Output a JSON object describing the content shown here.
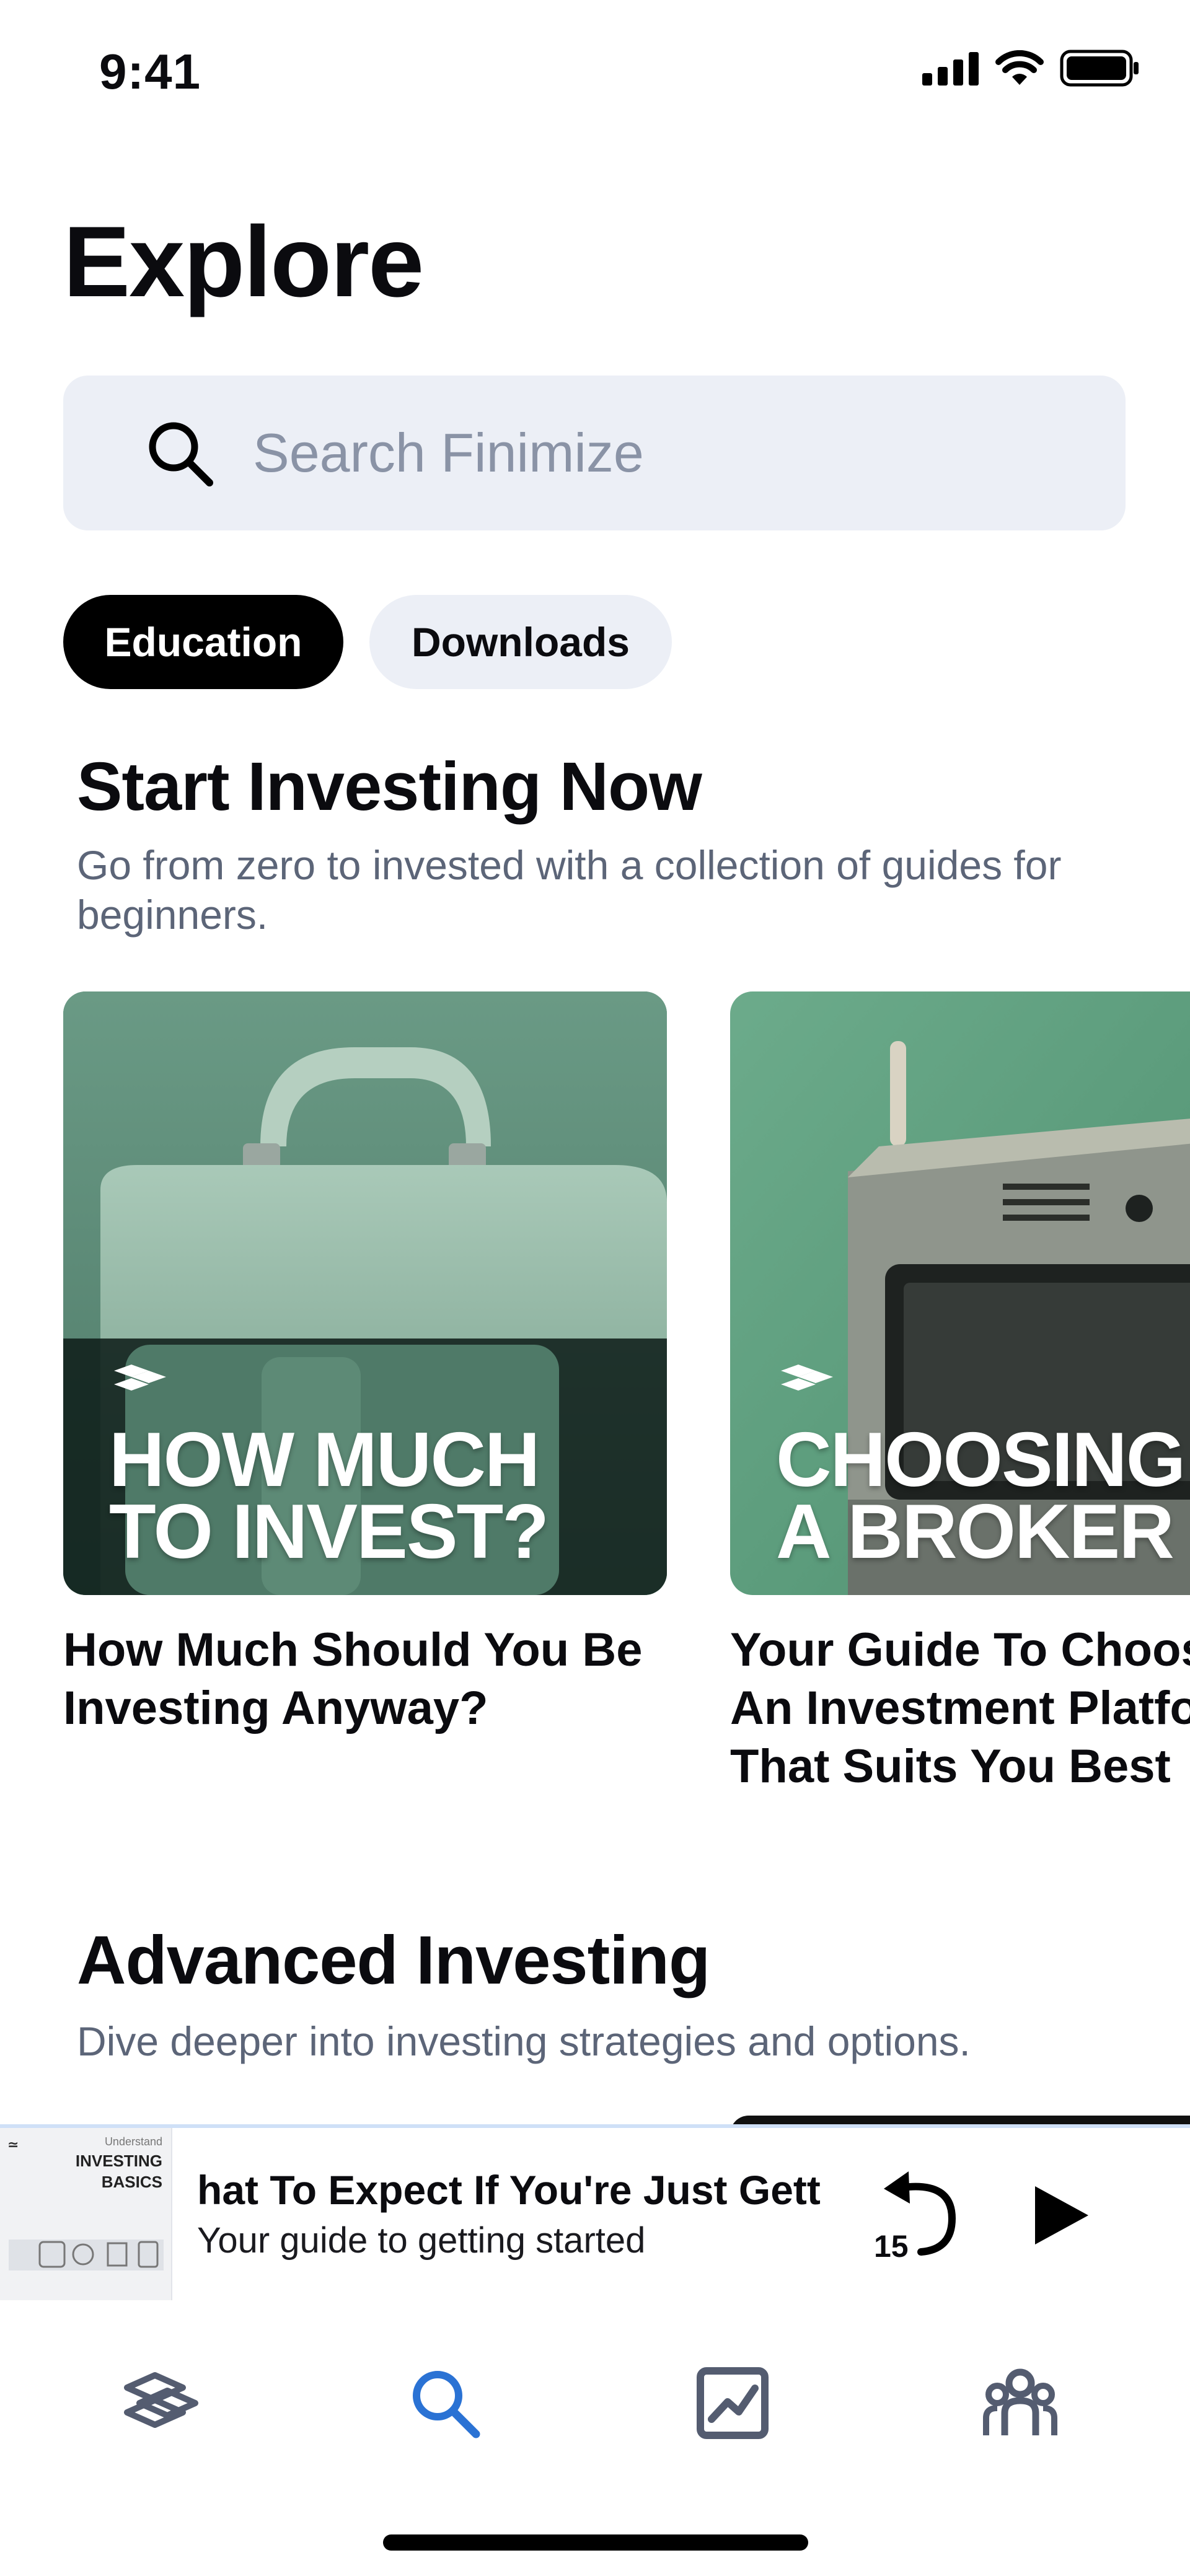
{
  "status_bar": {
    "time": "9:41"
  },
  "page": {
    "title": "Explore"
  },
  "search": {
    "placeholder": "Search Finimize"
  },
  "tabs": [
    {
      "label": "Education",
      "active": true
    },
    {
      "label": "Downloads",
      "active": false
    }
  ],
  "sections": [
    {
      "title": "Start Investing Now",
      "subtitle": "Go from zero to invested with a collection of guides for beginners.",
      "cards": [
        {
          "image_text": [
            "HOW MUCH",
            "TO INVEST?"
          ],
          "caption": [
            "How Much Should You Be",
            "Investing Anyway?"
          ]
        },
        {
          "image_text": [
            "CHOOSING",
            "A BROKER"
          ],
          "caption": [
            "Your Guide To Choosing",
            "An Investment Platform",
            "That Suits You Best"
          ]
        }
      ]
    },
    {
      "title": "Advanced Investing",
      "subtitle": "Dive deeper into investing strategies and options."
    }
  ],
  "player": {
    "art_label_small": "Understand",
    "art_label_1": "INVESTING",
    "art_label_2": "BASICS",
    "title": "hat To Expect If You're Just Getting Started",
    "subtitle": "Your guide to getting started",
    "skip_label": "15"
  },
  "colors": {
    "accent_blue": "#2a72d4",
    "nav_gray": "#545c70",
    "card_green": "#5e907c"
  },
  "nav_items": [
    {
      "icon": "finimize-logo-icon",
      "active": false
    },
    {
      "icon": "search-icon",
      "active": true
    },
    {
      "icon": "chart-icon",
      "active": false
    },
    {
      "icon": "community-icon",
      "active": false
    }
  ]
}
